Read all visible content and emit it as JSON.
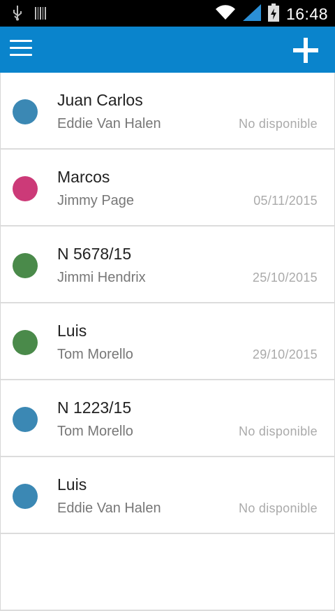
{
  "status_bar": {
    "time": "16:48",
    "icons": [
      "usb-icon",
      "barcode-icon",
      "wifi-icon",
      "signal-icon",
      "battery-charging-icon"
    ]
  },
  "app_bar": {
    "menu_icon": "hamburger-menu-icon",
    "add_icon": "plus-icon",
    "accent_color": "#0a84cc"
  },
  "items": [
    {
      "title": "Juan Carlos",
      "subtitle": "Eddie Van Halen",
      "date": "No disponible",
      "color": "#3b88b4"
    },
    {
      "title": "Marcos",
      "subtitle": "Jimmy Page",
      "date": "05/11/2015",
      "color": "#cc3a78"
    },
    {
      "title": "N 5678/15",
      "subtitle": "Jimmi Hendrix",
      "date": "25/10/2015",
      "color": "#4a8a4a"
    },
    {
      "title": "Luis",
      "subtitle": "Tom Morello",
      "date": "29/10/2015",
      "color": "#4a8a4a"
    },
    {
      "title": "N 1223/15",
      "subtitle": "Tom Morello",
      "date": "No disponible",
      "color": "#3b88b4"
    },
    {
      "title": "Luis",
      "subtitle": "Eddie Van Halen",
      "date": "No disponible",
      "color": "#3b88b4"
    },
    {
      "title": "",
      "subtitle": "",
      "date": "",
      "color": "#ffffff"
    }
  ]
}
